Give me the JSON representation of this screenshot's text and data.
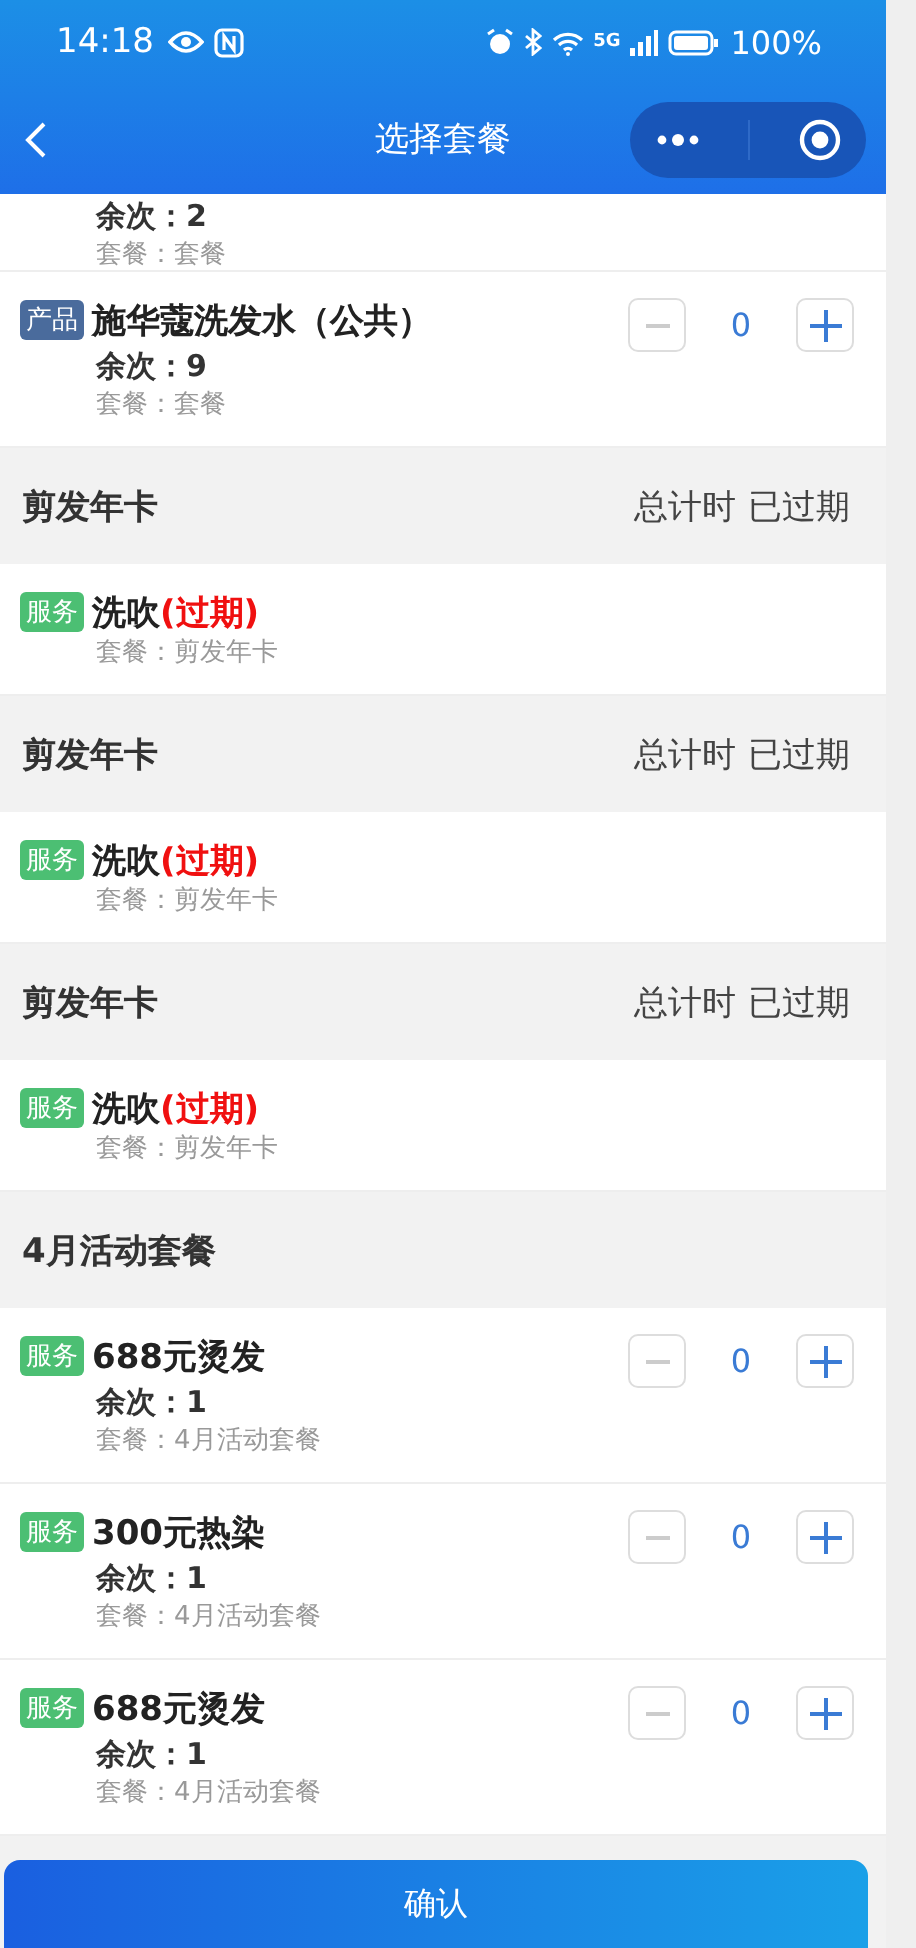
{
  "status_bar": {
    "time": "14:18",
    "network": "5G",
    "battery": "100%"
  },
  "nav": {
    "title": "选择套餐"
  },
  "list": [
    {
      "kind": "partial",
      "remaining_label": "余次：",
      "remaining": "2",
      "package_label": "套餐：",
      "package": "套餐"
    },
    {
      "kind": "item",
      "tag": {
        "text": "产品",
        "color": "#4a6b9c"
      },
      "name": "施华蔻洗发水（公共）",
      "remaining_label": "余次：",
      "remaining": "9",
      "package_label": "套餐：",
      "package": "套餐",
      "count": "0"
    },
    {
      "kind": "group",
      "title": "剪发年卡",
      "info": [
        "总计时",
        "已过期"
      ]
    },
    {
      "kind": "expired",
      "tag": {
        "text": "服务",
        "color": "#4cbf73"
      },
      "name": "洗吹",
      "expired_label": "(过期)",
      "package_label": "套餐：",
      "package": "剪发年卡"
    },
    {
      "kind": "group",
      "title": "剪发年卡",
      "info": [
        "总计时",
        "已过期"
      ]
    },
    {
      "kind": "expired",
      "tag": {
        "text": "服务",
        "color": "#4cbf73"
      },
      "name": "洗吹",
      "expired_label": "(过期)",
      "package_label": "套餐：",
      "package": "剪发年卡"
    },
    {
      "kind": "group",
      "title": "剪发年卡",
      "info": [
        "总计时",
        "已过期"
      ]
    },
    {
      "kind": "expired",
      "tag": {
        "text": "服务",
        "color": "#4cbf73"
      },
      "name": "洗吹",
      "expired_label": "(过期)",
      "package_label": "套餐：",
      "package": "剪发年卡"
    },
    {
      "kind": "group",
      "title": "4月活动套餐"
    },
    {
      "kind": "item",
      "tag": {
        "text": "服务",
        "color": "#4cbf73"
      },
      "name": "688元烫发",
      "remaining_label": "余次：",
      "remaining": "1",
      "package_label": "套餐：",
      "package": "4月活动套餐",
      "count": "0"
    },
    {
      "kind": "item",
      "tag": {
        "text": "服务",
        "color": "#4cbf73"
      },
      "name": "300元热染",
      "remaining_label": "余次：",
      "remaining": "1",
      "package_label": "套餐：",
      "package": "4月活动套餐",
      "count": "0"
    },
    {
      "kind": "item",
      "tag": {
        "text": "服务",
        "color": "#4cbf73"
      },
      "name": "688元烫发",
      "remaining_label": "余次：",
      "remaining": "1",
      "package_label": "套餐：",
      "package": "4月活动套餐",
      "count": "0"
    }
  ],
  "confirm_button": "确认"
}
